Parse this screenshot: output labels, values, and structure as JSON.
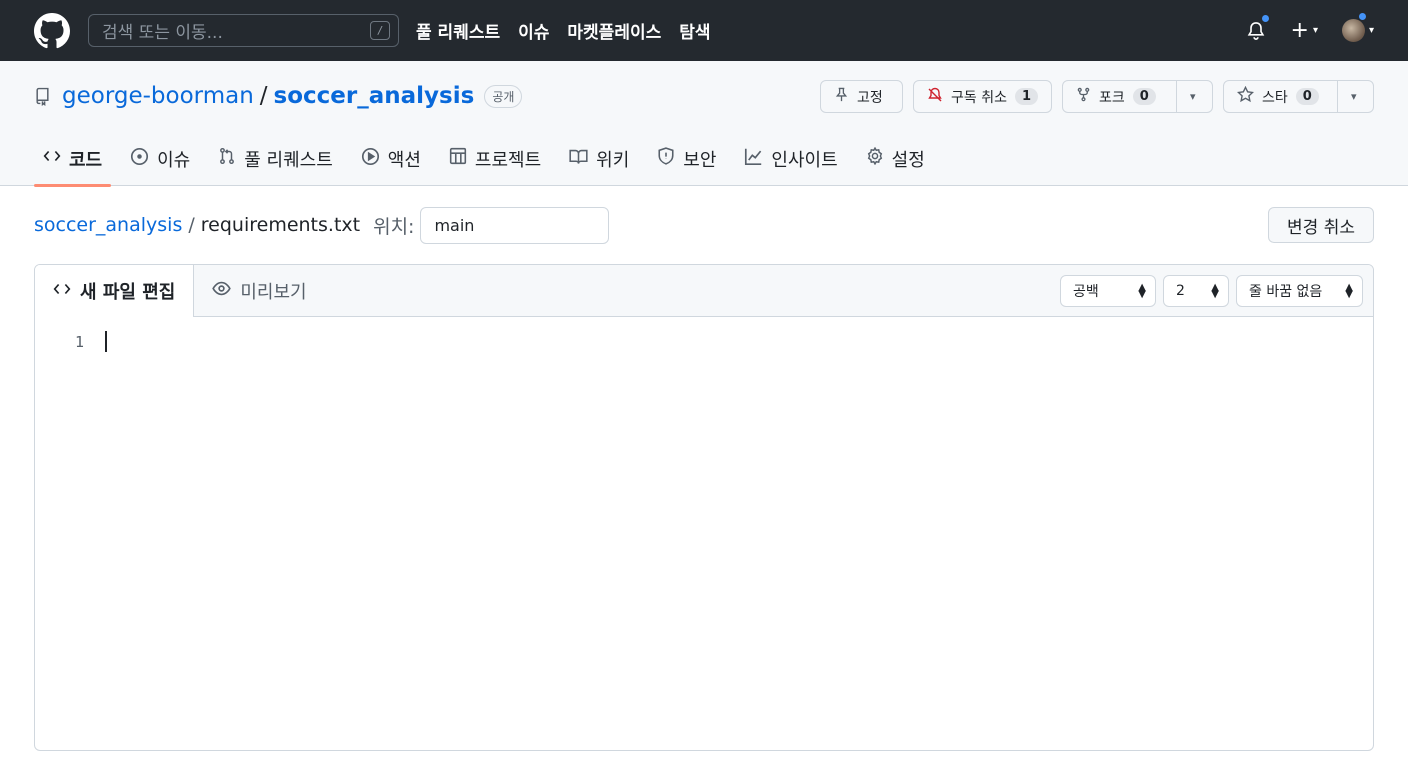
{
  "header": {
    "search_placeholder": "검색 또는 이동...",
    "search_shortcut": "/",
    "nav": [
      "풀 리퀘스트",
      "이슈",
      "마켓플레이스",
      "탐색"
    ]
  },
  "repo": {
    "owner": "george-boorman",
    "separator": "/",
    "name": "soccer_analysis",
    "visibility": "공개",
    "pin_label": "고정",
    "unwatch_label": "구독 취소",
    "watch_count": "1",
    "fork_label": "포크",
    "fork_count": "0",
    "star_label": "스타",
    "star_count": "0"
  },
  "tabs": [
    {
      "label": "코드",
      "icon": "code-icon",
      "active": true
    },
    {
      "label": "이슈",
      "icon": "issue-icon"
    },
    {
      "label": "풀 리퀘스트",
      "icon": "pull-request-icon"
    },
    {
      "label": "액션",
      "icon": "play-icon"
    },
    {
      "label": "프로젝트",
      "icon": "table-icon"
    },
    {
      "label": "위키",
      "icon": "book-icon"
    },
    {
      "label": "보안",
      "icon": "shield-icon"
    },
    {
      "label": "인사이트",
      "icon": "graph-icon"
    },
    {
      "label": "설정",
      "icon": "gear-icon"
    }
  ],
  "path": {
    "repo_link": "soccer_analysis",
    "separator": "/",
    "filename": "requirements.txt",
    "branch_label": "위치:",
    "branch_value": "main",
    "cancel_label": "변경 취소"
  },
  "editor": {
    "edit_tab": "새 파일 편집",
    "preview_tab": "미리보기",
    "indent_mode": "공백",
    "indent_size": "2",
    "wrap_mode": "줄 바꿈 없음",
    "line_number": "1"
  },
  "colors": {
    "header_bg": "#24292f",
    "link": "#0969da",
    "active_tab_underline": "#fd8c73",
    "notification_dot": "#4493f8"
  }
}
